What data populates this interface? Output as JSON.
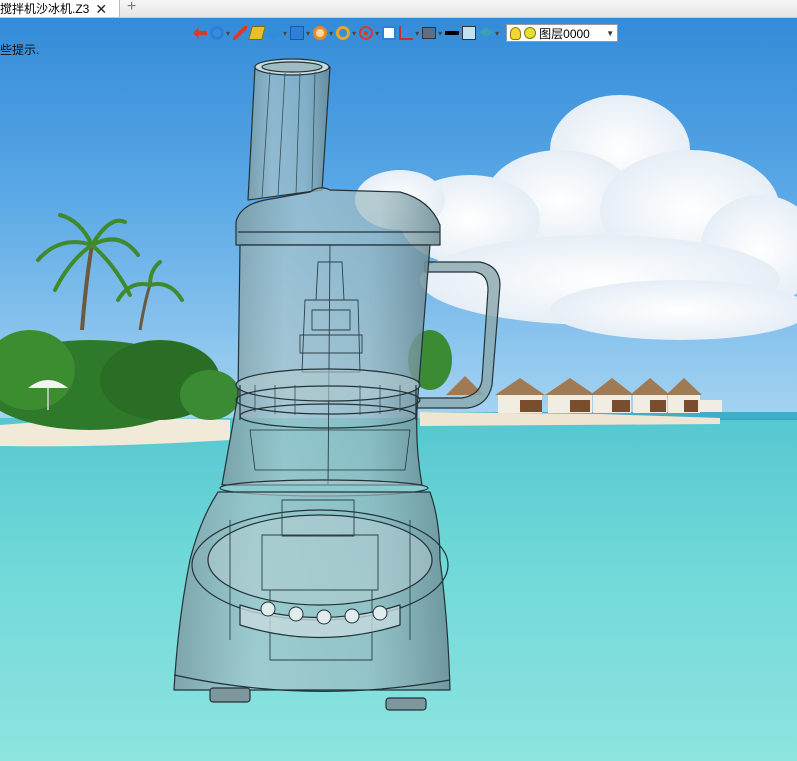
{
  "tab": {
    "title": "搅拌机沙冰机.Z3",
    "close_glyph": "✕",
    "new_tab_glyph": "+"
  },
  "viewport": {
    "hint": "些提示."
  },
  "toolbar": {
    "tools": [
      {
        "icon": "exit-view-icon",
        "color": "#d83a2e",
        "dropdown": false
      },
      {
        "icon": "render-mode-icon",
        "color": "#2e7fd8",
        "dropdown": true
      },
      {
        "icon": "pen-icon",
        "color": "#d83a2e",
        "dropdown": false
      },
      {
        "icon": "shaded-box-icon",
        "color": "#e8c02a",
        "dropdown": false
      },
      {
        "icon": "cube-icon",
        "color": "#2e8fd8",
        "dropdown": true
      },
      {
        "icon": "view-cube-icon",
        "color": "#2e7fd8",
        "dropdown": true
      },
      {
        "icon": "orbit-icon",
        "color": "#f08a1c",
        "dropdown": true
      },
      {
        "icon": "zoom-icon",
        "color": "#e8a62a",
        "dropdown": true
      },
      {
        "icon": "pan-icon",
        "color": "#d83a2e",
        "dropdown": true
      },
      {
        "icon": "select-window-icon",
        "color": "#2e7fd8",
        "dropdown": false
      },
      {
        "icon": "axis-icon",
        "color": "#c8302a",
        "dropdown": true
      },
      {
        "icon": "display-icon",
        "color": "#5a6f88",
        "dropdown": true
      },
      {
        "icon": "line-style-icon",
        "color": "#000000",
        "dropdown": false
      },
      {
        "icon": "color-swatch-icon",
        "color": "#bfe3f2",
        "dropdown": false
      },
      {
        "icon": "layer-manager-icon",
        "color": "#3aa0b8",
        "dropdown": true
      }
    ],
    "layer": {
      "name": "图层0000",
      "bulb_color": "#f5d62a",
      "dot_color": "#e8e02a"
    }
  }
}
